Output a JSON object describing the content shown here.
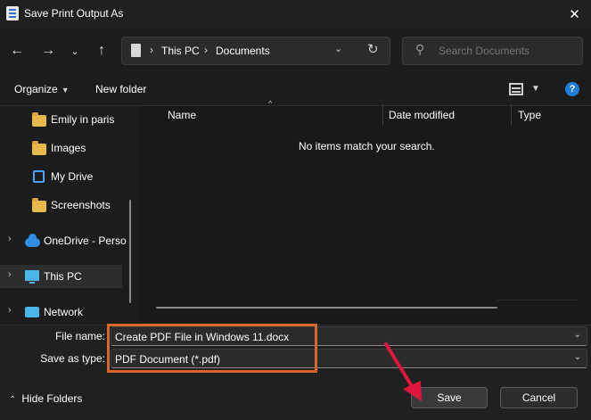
{
  "window": {
    "title": "Save Print Output As"
  },
  "nav": {
    "breadcrumb": [
      "This PC",
      "Documents"
    ],
    "search_placeholder": "Search Documents"
  },
  "commands": {
    "organize_label": "Organize",
    "new_folder_label": "New folder"
  },
  "sidebar": {
    "items": [
      {
        "label": "Emily in paris",
        "icon": "folder-icon"
      },
      {
        "label": "Images",
        "icon": "folder-icon"
      },
      {
        "label": "My Drive",
        "icon": "drive-icon"
      },
      {
        "label": "Screenshots",
        "icon": "folder-icon"
      },
      {
        "label": "OneDrive - Perso",
        "icon": "onedrive-icon"
      },
      {
        "label": "This PC",
        "icon": "pc-icon",
        "selected": true
      },
      {
        "label": "Network",
        "icon": "network-icon"
      }
    ]
  },
  "file_list": {
    "columns": [
      "Name",
      "Date modified",
      "Type"
    ],
    "empty_message": "No items match your search."
  },
  "form": {
    "file_name_label": "File name:",
    "file_name_value": "Create PDF File in Windows 11.docx",
    "save_type_label": "Save as type:",
    "save_type_value": "PDF Document (*.pdf)"
  },
  "footer": {
    "hide_folders_label": "Hide Folders",
    "save_label": "Save",
    "cancel_label": "Cancel"
  },
  "colors": {
    "highlight": "#d9662a",
    "annotation_arrow": "#e0163d",
    "accent": "#1f7cd8"
  }
}
